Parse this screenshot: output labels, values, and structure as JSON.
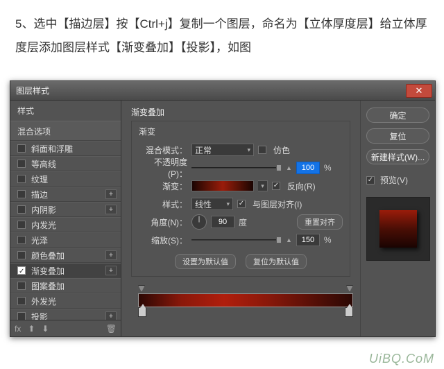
{
  "instruction": "5、选中【描边层】按【Ctrl+j】复制一个图层，命名为【立体厚度层】给立体厚度层添加图层样式【渐变叠加】【投影】，如图",
  "dialog": {
    "title": "图层样式",
    "ok": "确定",
    "reset": "复位",
    "newstyle": "新建样式(W)...",
    "preview_label": "预览(V)"
  },
  "left": {
    "head1": "样式",
    "head2": "混合选项",
    "items": [
      "斜面和浮雕",
      "等高线",
      "纹理",
      "描边",
      "内阴影",
      "内发光",
      "光泽",
      "颜色叠加",
      "渐变叠加",
      "图案叠加",
      "外发光",
      "投影"
    ]
  },
  "center": {
    "section": "渐变叠加",
    "sub": "渐变",
    "blend_label": "混合模式：",
    "blend_value": "正常",
    "dither": "仿色",
    "opacity_label": "不透明度(P)：",
    "opacity_value": "100",
    "opacity_unit": "%",
    "grad_label": "渐变：",
    "reverse": "反向(R)",
    "style_label": "样式：",
    "style_value": "线性",
    "align": "与图层对齐(I)",
    "angle_label": "角度(N)：",
    "angle_value": "90",
    "angle_unit": "度",
    "reset_align": "重置对齐",
    "scale_label": "缩放(S)：",
    "scale_value": "150",
    "scale_unit": "%",
    "btn_default": "设置为默认值",
    "btn_reset": "复位为默认值"
  },
  "watermark": "UiBQ.CoM",
  "footer": {
    "fx": "fx"
  }
}
